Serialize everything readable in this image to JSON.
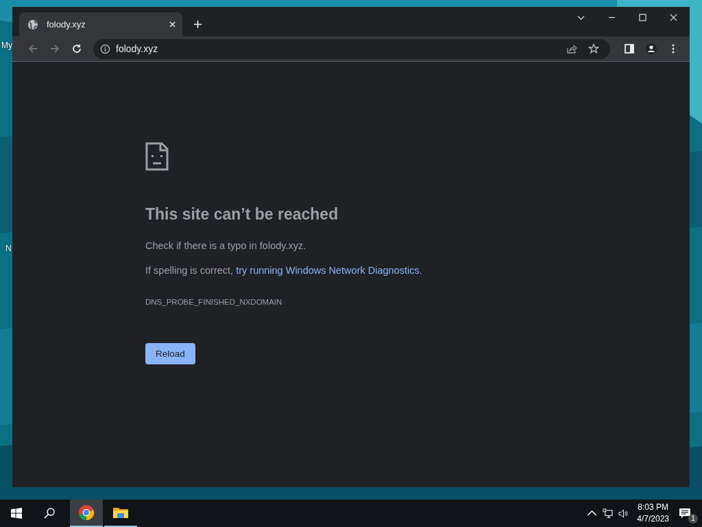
{
  "desktop": {
    "icon_labels": [
      "My",
      "N"
    ]
  },
  "browser": {
    "tabs": [
      {
        "title": "folody.xyz",
        "selected": true
      }
    ],
    "address_bar": {
      "value": "folody.xyz"
    },
    "error_page": {
      "title": "This site can’t be reached",
      "message": "Check if there is a typo in folody.xyz.",
      "suggestion_prefix": "If spelling is correct, ",
      "suggestion_link": "try running Windows Network Diagnostics",
      "suggestion_suffix": ".",
      "error_code": "DNS_PROBE_FINISHED_NXDOMAIN",
      "button": "Reload"
    }
  },
  "taskbar": {
    "apps": [
      {
        "kind": "chrome",
        "selected": true
      },
      {
        "kind": "explorer",
        "selected": false
      }
    ],
    "time": "8:03 PM",
    "date": "4/7/2023",
    "notification_count": "1"
  }
}
